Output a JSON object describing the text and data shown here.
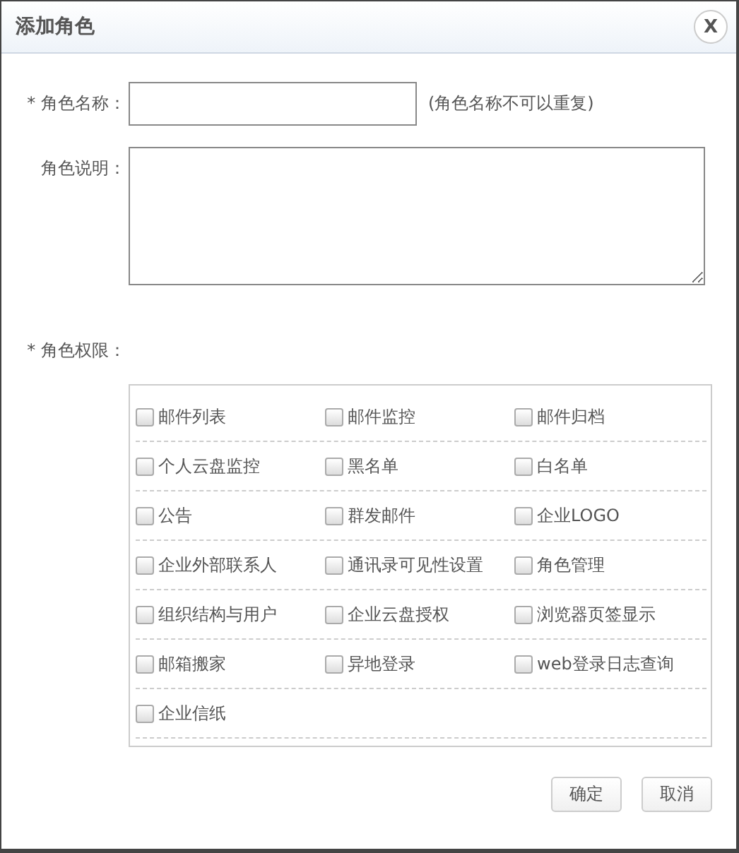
{
  "window": {
    "title": "添加角色",
    "close": "X"
  },
  "form": {
    "name": {
      "required_mark": "*",
      "label": "角色名称：",
      "hint": "(角色名称不可以重复)"
    },
    "description": {
      "label": "角色说明："
    },
    "permissions": {
      "required_mark": "*",
      "label": "角色权限：",
      "items": [
        {
          "label": "邮件列表",
          "checked": false
        },
        {
          "label": "邮件监控",
          "checked": false
        },
        {
          "label": "邮件归档",
          "checked": false
        },
        {
          "label": "个人云盘监控",
          "checked": false
        },
        {
          "label": "黑名单",
          "checked": false
        },
        {
          "label": "白名单",
          "checked": false
        },
        {
          "label": "公告",
          "checked": false
        },
        {
          "label": "群发邮件",
          "checked": false
        },
        {
          "label": "企业LOGO",
          "checked": false
        },
        {
          "label": "企业外部联系人",
          "checked": false
        },
        {
          "label": "通讯录可见性设置",
          "checked": false
        },
        {
          "label": "角色管理",
          "checked": false
        },
        {
          "label": "组织结构与用户",
          "checked": false
        },
        {
          "label": "企业云盘授权",
          "checked": false
        },
        {
          "label": "浏览器页签显示",
          "checked": false
        },
        {
          "label": "邮箱搬家",
          "checked": false
        },
        {
          "label": "异地登录",
          "checked": false
        },
        {
          "label": "web登录日志查询",
          "checked": false
        },
        {
          "label": "企业信纸",
          "checked": false
        }
      ]
    }
  },
  "buttons": [
    "确定",
    "取消"
  ]
}
